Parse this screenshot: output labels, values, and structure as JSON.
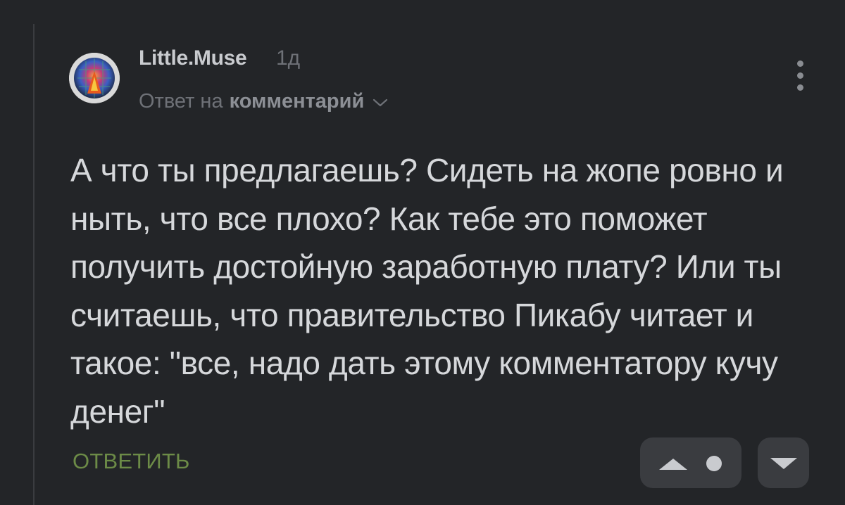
{
  "comment": {
    "author": "Little.Muse",
    "time": "1д",
    "reply_prefix": "Ответ на",
    "reply_link": "комментарий",
    "text": "А что ты предлагаешь? Сидеть на жопе ровно и ныть, что все плохо? Как тебе это поможет получить достойную заработную плату? Или ты считаешь, что правительство Пикабу читает и такое: \"все, надо дать этому комментатору кучу денег\"",
    "reply_button": "ОТВЕТИТЬ"
  },
  "icons": {
    "menu": "more-vertical-icon",
    "reply_expand": "chevron-down-icon",
    "upvote": "triangle-up-icon",
    "rating": "dot-icon",
    "downvote": "triangle-down-icon"
  },
  "colors": {
    "background": "#232528",
    "text": "#d6d8db",
    "muted": "#6e7177",
    "accent_green": "#6c8b47",
    "button_bg": "#3a3c40"
  }
}
